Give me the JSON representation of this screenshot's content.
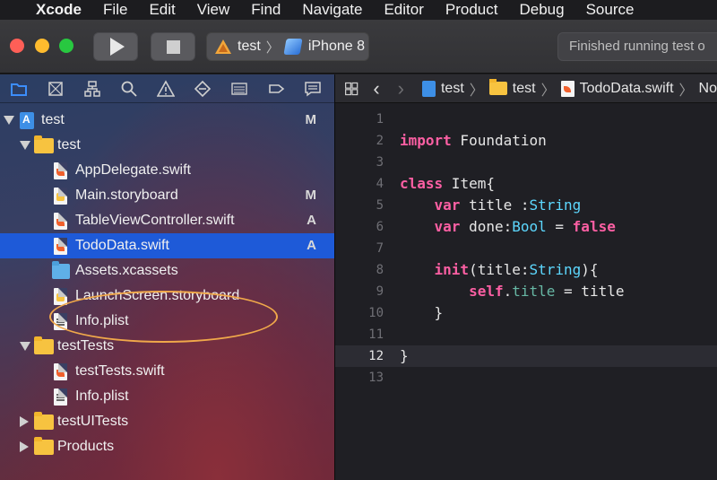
{
  "menubar": {
    "apple": "",
    "app": "Xcode",
    "items": [
      "File",
      "Edit",
      "View",
      "Find",
      "Navigate",
      "Editor",
      "Product",
      "Debug",
      "Source"
    ]
  },
  "toolbar": {
    "scheme_project": "test",
    "scheme_device": "iPhone 8",
    "status": "Finished running test o"
  },
  "navigator": {
    "tree": [
      {
        "label": "test",
        "badge": "M",
        "kind": "project",
        "depth": 0,
        "disclosure": "down"
      },
      {
        "label": "test",
        "badge": "",
        "kind": "folder",
        "depth": 1,
        "disclosure": "down"
      },
      {
        "label": "AppDelegate.swift",
        "badge": "",
        "kind": "swift",
        "depth": 2
      },
      {
        "label": "Main.storyboard",
        "badge": "M",
        "kind": "storyboard",
        "depth": 2
      },
      {
        "label": "TableViewController.swift",
        "badge": "A",
        "kind": "swift",
        "depth": 2
      },
      {
        "label": "TodoData.swift",
        "badge": "A",
        "kind": "swift",
        "depth": 2,
        "selected": true
      },
      {
        "label": "Assets.xcassets",
        "badge": "",
        "kind": "assets",
        "depth": 2
      },
      {
        "label": "LaunchScreen.storyboard",
        "badge": "",
        "kind": "storyboard",
        "depth": 2
      },
      {
        "label": "Info.plist",
        "badge": "",
        "kind": "plist",
        "depth": 2
      },
      {
        "label": "testTests",
        "badge": "",
        "kind": "folder",
        "depth": 1,
        "disclosure": "down"
      },
      {
        "label": "testTests.swift",
        "badge": "",
        "kind": "swift",
        "depth": 2
      },
      {
        "label": "Info.plist",
        "badge": "",
        "kind": "plist",
        "depth": 2
      },
      {
        "label": "testUITests",
        "badge": "",
        "kind": "folder",
        "depth": 1,
        "disclosure": "right"
      },
      {
        "label": "Products",
        "badge": "",
        "kind": "folder",
        "depth": 1,
        "disclosure": "right"
      }
    ]
  },
  "jumpbar": {
    "crumbs": [
      "test",
      "test",
      "TodoData.swift",
      "No"
    ]
  },
  "editor": {
    "current_line": 12,
    "lines": [
      {
        "n": "1",
        "tokens": []
      },
      {
        "n": "2",
        "tokens": [
          {
            "t": "import",
            "c": "kw"
          },
          {
            "t": " Foundation",
            "c": "plain"
          }
        ]
      },
      {
        "n": "3",
        "tokens": []
      },
      {
        "n": "4",
        "tokens": [
          {
            "t": "class",
            "c": "kw"
          },
          {
            "t": " Item{",
            "c": "plain"
          }
        ]
      },
      {
        "n": "5",
        "tokens": [
          {
            "t": "    ",
            "c": "plain"
          },
          {
            "t": "var",
            "c": "kw"
          },
          {
            "t": " title :",
            "c": "plain"
          },
          {
            "t": "String",
            "c": "ty"
          }
        ]
      },
      {
        "n": "6",
        "tokens": [
          {
            "t": "    ",
            "c": "plain"
          },
          {
            "t": "var",
            "c": "kw"
          },
          {
            "t": " done:",
            "c": "plain"
          },
          {
            "t": "Bool",
            "c": "ty"
          },
          {
            "t": " = ",
            "c": "plain"
          },
          {
            "t": "false",
            "c": "kw"
          }
        ]
      },
      {
        "n": "7",
        "tokens": []
      },
      {
        "n": "8",
        "tokens": [
          {
            "t": "    ",
            "c": "plain"
          },
          {
            "t": "init",
            "c": "kw"
          },
          {
            "t": "(title:",
            "c": "plain"
          },
          {
            "t": "String",
            "c": "ty"
          },
          {
            "t": "){",
            "c": "plain"
          }
        ]
      },
      {
        "n": "9",
        "tokens": [
          {
            "t": "        ",
            "c": "plain"
          },
          {
            "t": "self",
            "c": "kw"
          },
          {
            "t": ".",
            "c": "plain"
          },
          {
            "t": "title",
            "c": "prop"
          },
          {
            "t": " = title",
            "c": "plain"
          }
        ]
      },
      {
        "n": "10",
        "tokens": [
          {
            "t": "    }",
            "c": "plain"
          }
        ]
      },
      {
        "n": "11",
        "tokens": []
      },
      {
        "n": "12",
        "tokens": [
          {
            "t": "}",
            "c": "plain"
          }
        ]
      },
      {
        "n": "13",
        "tokens": []
      }
    ]
  },
  "colors": {
    "selection": "#1e5ad8",
    "keyword": "#fc5fa3",
    "type": "#5dd8ff",
    "annotation": "#f0a84a"
  }
}
